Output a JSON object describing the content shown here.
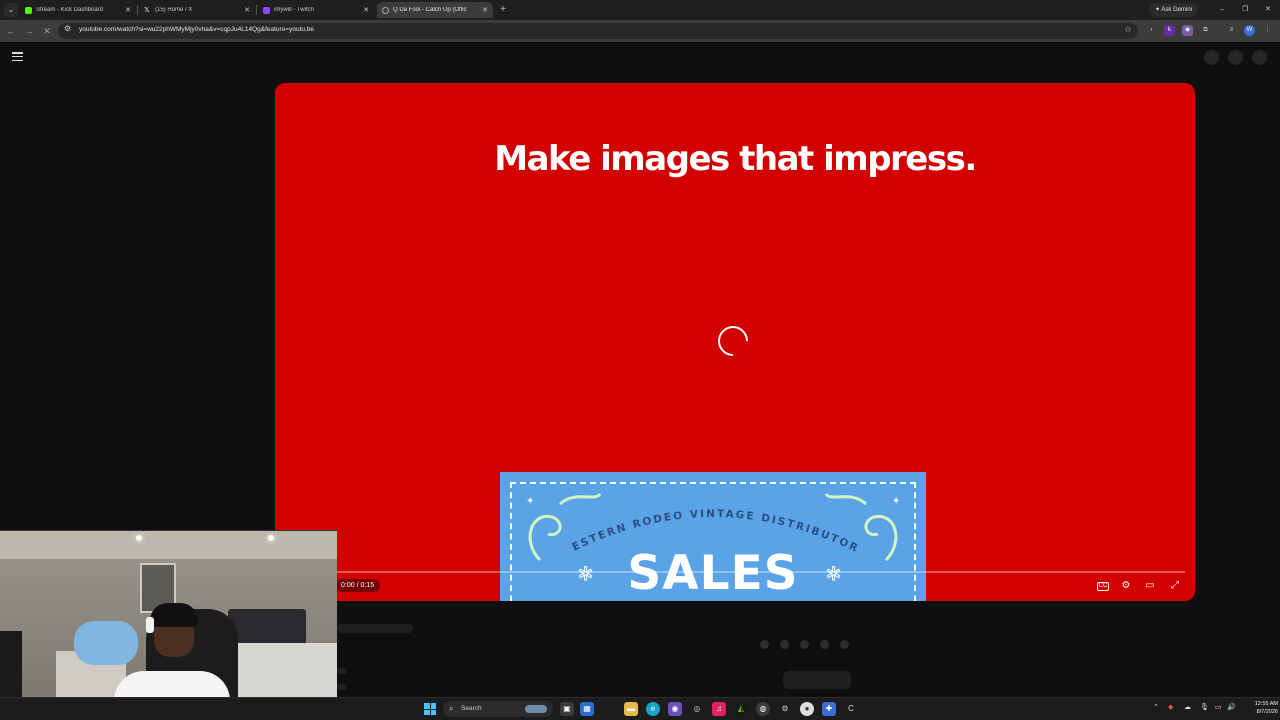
{
  "browser": {
    "tabs": [
      {
        "title": "Stream - Kick Dashboard",
        "color": "#53fc18",
        "active": false
      },
      {
        "title": "(15) Home / X",
        "color": "#ffffff",
        "active": false
      },
      {
        "title": "imywill - Twitch",
        "color": "#9146ff",
        "active": false
      },
      {
        "title": "Q Da Fool - Catch Up (Offic",
        "color": "#aaaaaa",
        "active": true
      }
    ],
    "new_tab": "+",
    "ask_gemini": "Ask Gemini",
    "url": "youtube.com/watch?si=wu22phWMyMjy0vha&v=cqpJu4L14Qg&feature=youtu.be",
    "window_controls": {
      "minimize": "–",
      "restore": "❐",
      "close": "✕"
    }
  },
  "video": {
    "headline": "Make images that impress.",
    "card_title": "WESTERN RODEO VINTAGE DISTRIBUTORS",
    "card_big_text": "SALES",
    "time": "0:00 / 0:15",
    "progress": 0,
    "accent": "#d30000"
  },
  "taskbar": {
    "search_placeholder": "Search",
    "time": "12:55 AM",
    "date": "8/7/2026"
  }
}
